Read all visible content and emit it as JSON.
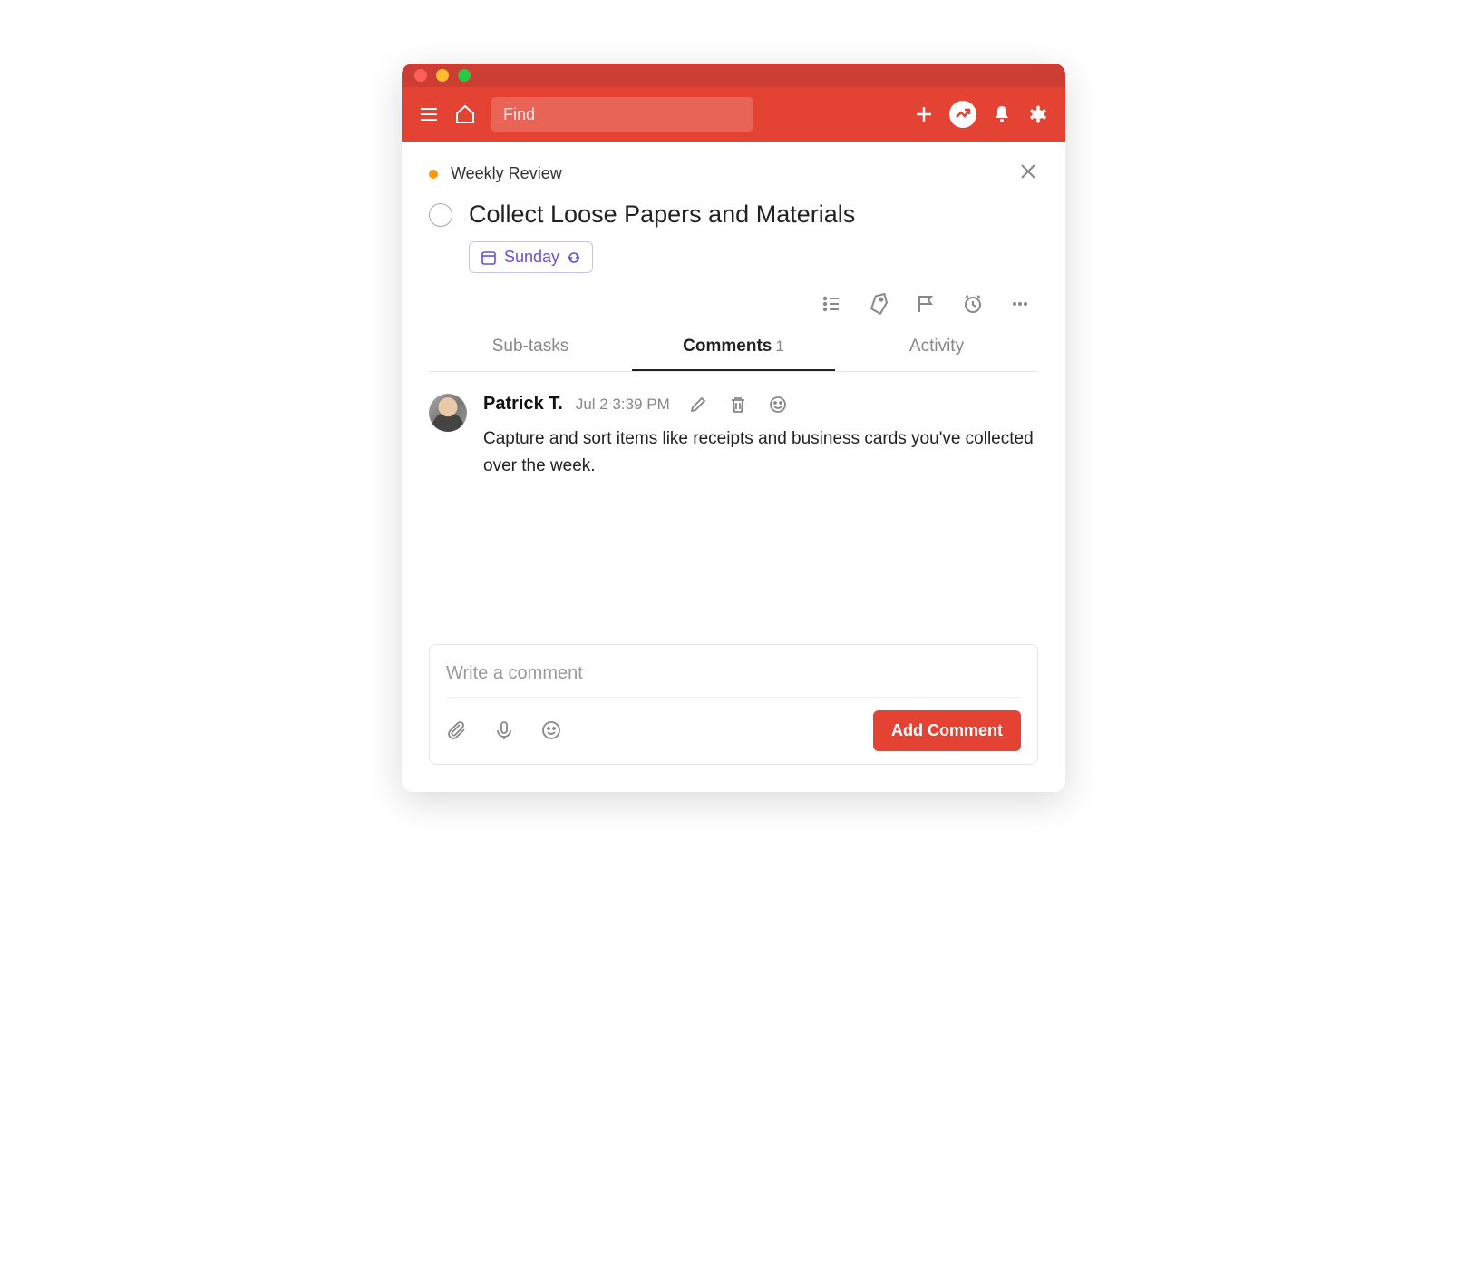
{
  "header": {
    "search_placeholder": "Find"
  },
  "task": {
    "project_name": "Weekly Review",
    "project_color": "#f39c12",
    "title": "Collect Loose Papers and Materials",
    "due_label": "Sunday"
  },
  "tabs": {
    "subtasks_label": "Sub-tasks",
    "comments_label": "Comments",
    "comments_count": "1",
    "activity_label": "Activity"
  },
  "comment": {
    "author": "Patrick T.",
    "timestamp": "Jul 2 3:39 PM",
    "text": "Capture and sort items like receipts and business cards you've collected over the week."
  },
  "composer": {
    "placeholder": "Write a comment",
    "button_label": "Add Comment"
  }
}
